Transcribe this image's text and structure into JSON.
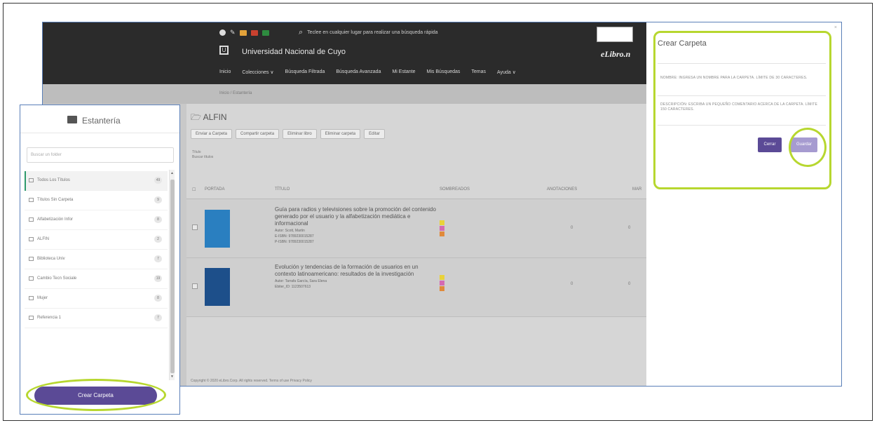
{
  "header": {
    "search_placeholder": "Teclee en cualquier lugar para realizar una búsqueda rápida",
    "university": "Universidad Nacional de Cuyo",
    "brand": "eLibro.n",
    "nav": [
      "Inicio",
      "Colecciones ∨",
      "Búsqueda Filtrada",
      "Búsqueda Avanzada",
      "Mi Estante",
      "Mis Búsquedas",
      "Temas",
      "Ayuda ∨"
    ]
  },
  "breadcrumb": "Inicio / Estantería",
  "folder": {
    "title": "ALFIN",
    "actions": [
      "Enviar a Carpeta",
      "Compartir carpeta",
      "Eliminar libro",
      "Eliminar carpeta",
      "Editar"
    ],
    "filter_label": "Título",
    "filter_placeholder": "Buscar títulos"
  },
  "table": {
    "headers": [
      "PORTADA",
      "TÍTULO",
      "SOMBREADOS",
      "ANOTACIONES",
      "MAR"
    ],
    "rows": [
      {
        "title": "Guía para radios y televisiones sobre la promoción del contenido generado por el usuario y la alfabetización mediática e informacional",
        "author": "Autor: Scott, Martin",
        "isbn1": "E-ISBN: 9789230015287",
        "isbn2": "P-ISBN: 9789230015287",
        "anotaciones": "0",
        "mar": "0",
        "cover_color": "#2a7fc0"
      },
      {
        "title": "Evolución y tendencias de la formación de usuarios en un contexto latinoamericano: resultados de la investigación",
        "author": "Autor: Tarrafa García, Sara Elena",
        "isbn1": "Ebiter_ID: 1123507613",
        "isbn2": "",
        "anotaciones": "0",
        "mar": "0",
        "cover_color": "#1d4f8a"
      }
    ]
  },
  "footer": "Copyright © 2020 eLibro.Corp. All rights reserved.   Terms of use   Privacy Policy",
  "modal": {
    "title": "Crear Carpeta",
    "nombre_hint": "NOMBRE: INGRESA UN NOMBRE PARA LA CARPETA. LÍMITE DE 30 CARACTERES.",
    "descripcion_hint": "DESCRIPCIÓN: ESCRIBA UN PEQUEÑO COMENTARIO ACERCA DE LA CARPETA. LÍMITE 150 CARACTERES.",
    "btn_cerrar": "Cerrar",
    "btn_guardar": "Guardar",
    "close_icon": "×"
  },
  "sidebar": {
    "title": "Estantería",
    "search_placeholder": "Buscar un folder",
    "items": [
      {
        "label": "Todos Los Títulos",
        "count": "49"
      },
      {
        "label": "Títulos Sin Carpeta",
        "count": "9"
      },
      {
        "label": "Alfabetización Infor",
        "count": "8"
      },
      {
        "label": "ALFIN",
        "count": "2"
      },
      {
        "label": "Biblioteca Univ",
        "count": "7"
      },
      {
        "label": "Cambio Tecn Sociale",
        "count": "19"
      },
      {
        "label": "Mujer",
        "count": "8"
      },
      {
        "label": "Referencia 1",
        "count": "7"
      }
    ],
    "create_button": "Crear Carpeta"
  },
  "colors": {
    "accent": "#5b4a96",
    "highlight": "#b7d72f",
    "header_bg": "#2b2b2b"
  }
}
